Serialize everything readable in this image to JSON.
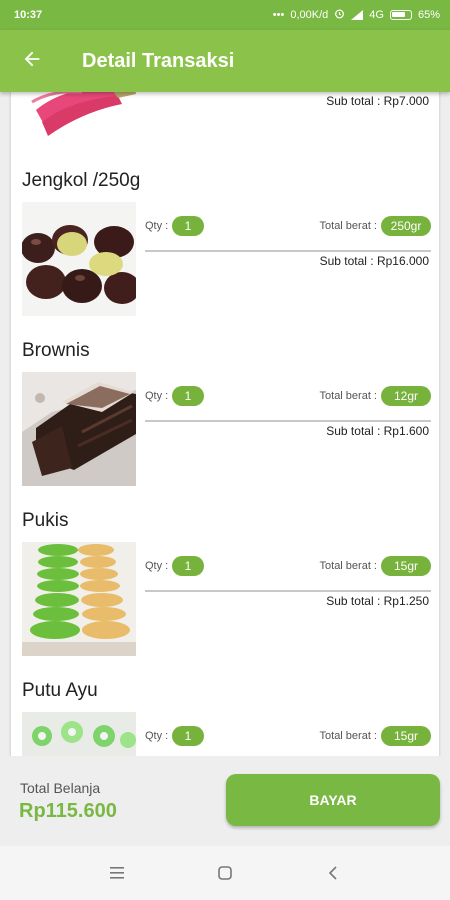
{
  "status_bar": {
    "time": "10:37",
    "network_speed": "0,00K/d",
    "network_type": "4G",
    "battery": "65%",
    "icons": [
      "alarm-icon",
      "signal-icon",
      "battery-icon"
    ]
  },
  "app_bar": {
    "title": "Detail Transaksi",
    "back_icon": "arrow-left-icon"
  },
  "top_partial_item": {
    "subtotal": "Sub total : Rp7.000"
  },
  "items": [
    {
      "name": "Jengkol /250g",
      "qty_label": "Qty :",
      "qty": "1",
      "weight_label": "Total berat :",
      "weight": "250gr",
      "subtotal": "Sub total : Rp16.000"
    },
    {
      "name": "Brownis",
      "qty_label": "Qty :",
      "qty": "1",
      "weight_label": "Total berat :",
      "weight": "12gr",
      "subtotal": "Sub total : Rp1.600"
    },
    {
      "name": "Pukis",
      "qty_label": "Qty :",
      "qty": "1",
      "weight_label": "Total berat :",
      "weight": "15gr",
      "subtotal": "Sub total : Rp1.250"
    },
    {
      "name": "Putu Ayu",
      "qty_label": "Qty :",
      "qty": "1",
      "weight_label": "Total berat :",
      "weight": "15gr",
      "subtotal": ""
    }
  ],
  "footer": {
    "total_label": "Total Belanja",
    "total_value": "Rp115.600",
    "pay_button": "BAYAR"
  },
  "colors": {
    "primary": "#8bc34a",
    "primary_dark": "#7ab844",
    "pill": "#77b23c"
  },
  "nav_bar": {
    "icons": [
      "menu-icon",
      "home-square-icon",
      "back-chevron-icon"
    ]
  }
}
